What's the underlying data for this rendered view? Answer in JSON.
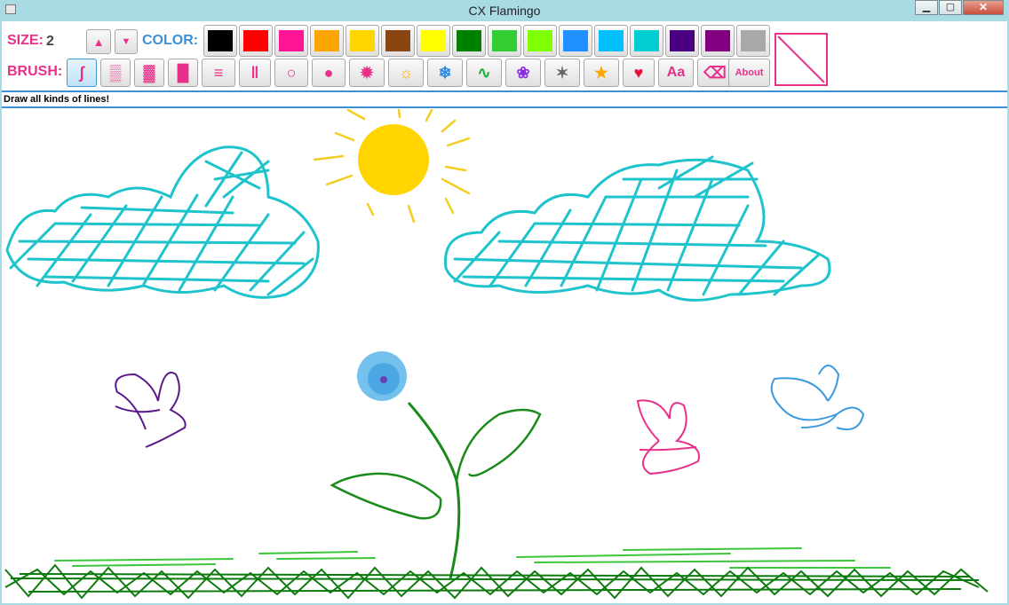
{
  "window": {
    "title": "CX Flamingo"
  },
  "toolbar": {
    "size_label": "SIZE:",
    "size_value": "2",
    "color_label": "COLOR:",
    "brush_label": "BRUSH:",
    "about_label": "About"
  },
  "colors": [
    "#000000",
    "#ff0000",
    "#ff1493",
    "#ffa500",
    "#ffd700",
    "#8b4513",
    "#ffff00",
    "#008000",
    "#32cd32",
    "#7fff00",
    "#1e90ff",
    "#00bfff",
    "#00ced1",
    "#4b0082",
    "#800080",
    "#a9a9a9"
  ],
  "brushes": [
    {
      "name": "line-brush",
      "glyph": "ʃ",
      "selected": true
    },
    {
      "name": "spray-light-brush",
      "glyph": "▒"
    },
    {
      "name": "spray-dense-brush",
      "glyph": "▓"
    },
    {
      "name": "solid-brush",
      "glyph": "█"
    },
    {
      "name": "horizontal-lines-brush",
      "glyph": "≡"
    },
    {
      "name": "vertical-lines-brush",
      "glyph": "‖"
    },
    {
      "name": "ring-brush",
      "glyph": "○"
    },
    {
      "name": "dot-brush",
      "glyph": "●"
    },
    {
      "name": "burst-brush",
      "glyph": "✹"
    },
    {
      "name": "sun-brush",
      "glyph": "☼"
    },
    {
      "name": "snowflake-brush",
      "glyph": "❄"
    },
    {
      "name": "squiggle-brush",
      "glyph": "∿"
    },
    {
      "name": "flower-brush",
      "glyph": "❀"
    },
    {
      "name": "gray-star-brush",
      "glyph": "✶"
    },
    {
      "name": "star-brush",
      "glyph": "★"
    },
    {
      "name": "heart-brush",
      "glyph": "♥"
    },
    {
      "name": "text-brush",
      "glyph": "Aa"
    },
    {
      "name": "eraser-brush",
      "glyph": "⌫"
    }
  ],
  "brush_colors": [
    "#e8308a",
    "#e8308a",
    "#e8308a",
    "#e8308a",
    "#e8308a",
    "#e8308a",
    "#e8308a",
    "#e8308a",
    "#e8308a",
    "#ffb000",
    "#2d8be0",
    "#1fae3a",
    "#8a2be2",
    "#666666",
    "#ffa500",
    "#e8103a",
    "#e8308a",
    "#e8308a"
  ],
  "status": {
    "text": "Draw all kinds of lines!"
  }
}
